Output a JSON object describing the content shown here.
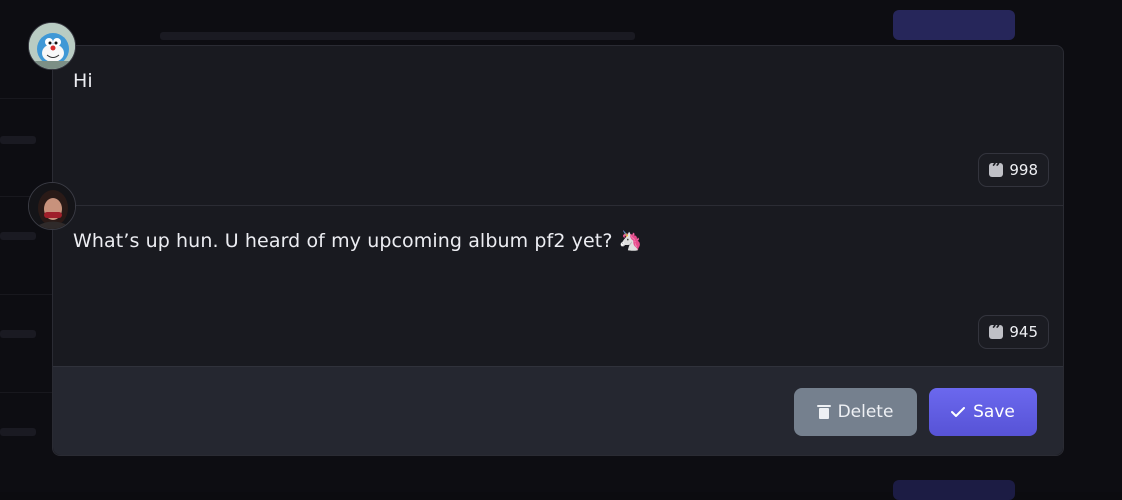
{
  "messages": [
    {
      "text": "Hi",
      "count": "998",
      "avatar": "doraemon-avatar"
    },
    {
      "text": "What’s up hun. U heard of my upcoming album pf2 yet? 🦄",
      "count": "945",
      "avatar": "woman-avatar"
    }
  ],
  "actions": {
    "delete_label": "Delete",
    "save_label": "Save"
  },
  "icons": {
    "count": "quote-icon",
    "delete": "trash-icon",
    "save": "check-icon"
  },
  "colors": {
    "modal_bg": "#191a20",
    "footer_bg": "#252730",
    "delete_button": "#75808e",
    "save_button": "#5f5ce5",
    "text": "#ecedf2"
  }
}
